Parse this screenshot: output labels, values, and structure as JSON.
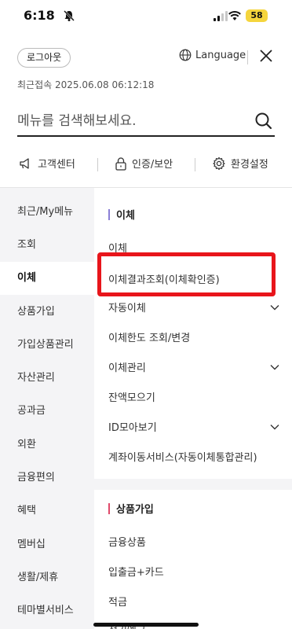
{
  "status_bar": {
    "time": "6:18",
    "battery": "58"
  },
  "header": {
    "logout_label": "로그아웃",
    "language_label": "Language",
    "last_login": "최근접속 2025.06.08 06:12:18"
  },
  "search": {
    "placeholder": "메뉴를 검색해보세요."
  },
  "quick_menu": [
    {
      "label": "고객센터",
      "icon": "megaphone-icon"
    },
    {
      "label": "인증/보안",
      "icon": "lock-icon"
    },
    {
      "label": "환경설정",
      "icon": "gear-icon"
    }
  ],
  "sidebar": {
    "active_index": 2,
    "items": [
      {
        "label": "최근/My메뉴"
      },
      {
        "label": "조회"
      },
      {
        "label": "이체"
      },
      {
        "label": "상품가입"
      },
      {
        "label": "가입상품관리"
      },
      {
        "label": "자산관리"
      },
      {
        "label": "공과금"
      },
      {
        "label": "외환"
      },
      {
        "label": "금융편의"
      },
      {
        "label": "혜택"
      },
      {
        "label": "멤버십"
      },
      {
        "label": "생활/제휴"
      },
      {
        "label": "테마별서비스"
      }
    ]
  },
  "content": {
    "groups": [
      {
        "title": "이체",
        "accent_color": "#8b7fd6",
        "items": [
          {
            "label": "이체",
            "expandable": false
          },
          {
            "label": "이체결과조회(이체확인증)",
            "expandable": false
          },
          {
            "label": "자동이체",
            "expandable": true
          },
          {
            "label": "이체한도 조회/변경",
            "expandable": false
          },
          {
            "label": "이체관리",
            "expandable": true
          },
          {
            "label": "잔액모으기",
            "expandable": false
          },
          {
            "label": "ID모아보기",
            "expandable": true
          },
          {
            "label": "계좌이동서비스(자동이체통합관리)",
            "expandable": false
          }
        ]
      },
      {
        "title": "상품가입",
        "accent_color": "#e04a6a",
        "items": [
          {
            "label": "금융상품",
            "expandable": false
          },
          {
            "label": "입출금+카드",
            "expandable": false
          },
          {
            "label": "적금",
            "expandable": false
          },
          {
            "label": "정기예금",
            "expandable": false
          }
        ]
      }
    ]
  },
  "colors": {
    "highlight": "#e8151b",
    "sidebar_bg": "#f4f4f6"
  }
}
